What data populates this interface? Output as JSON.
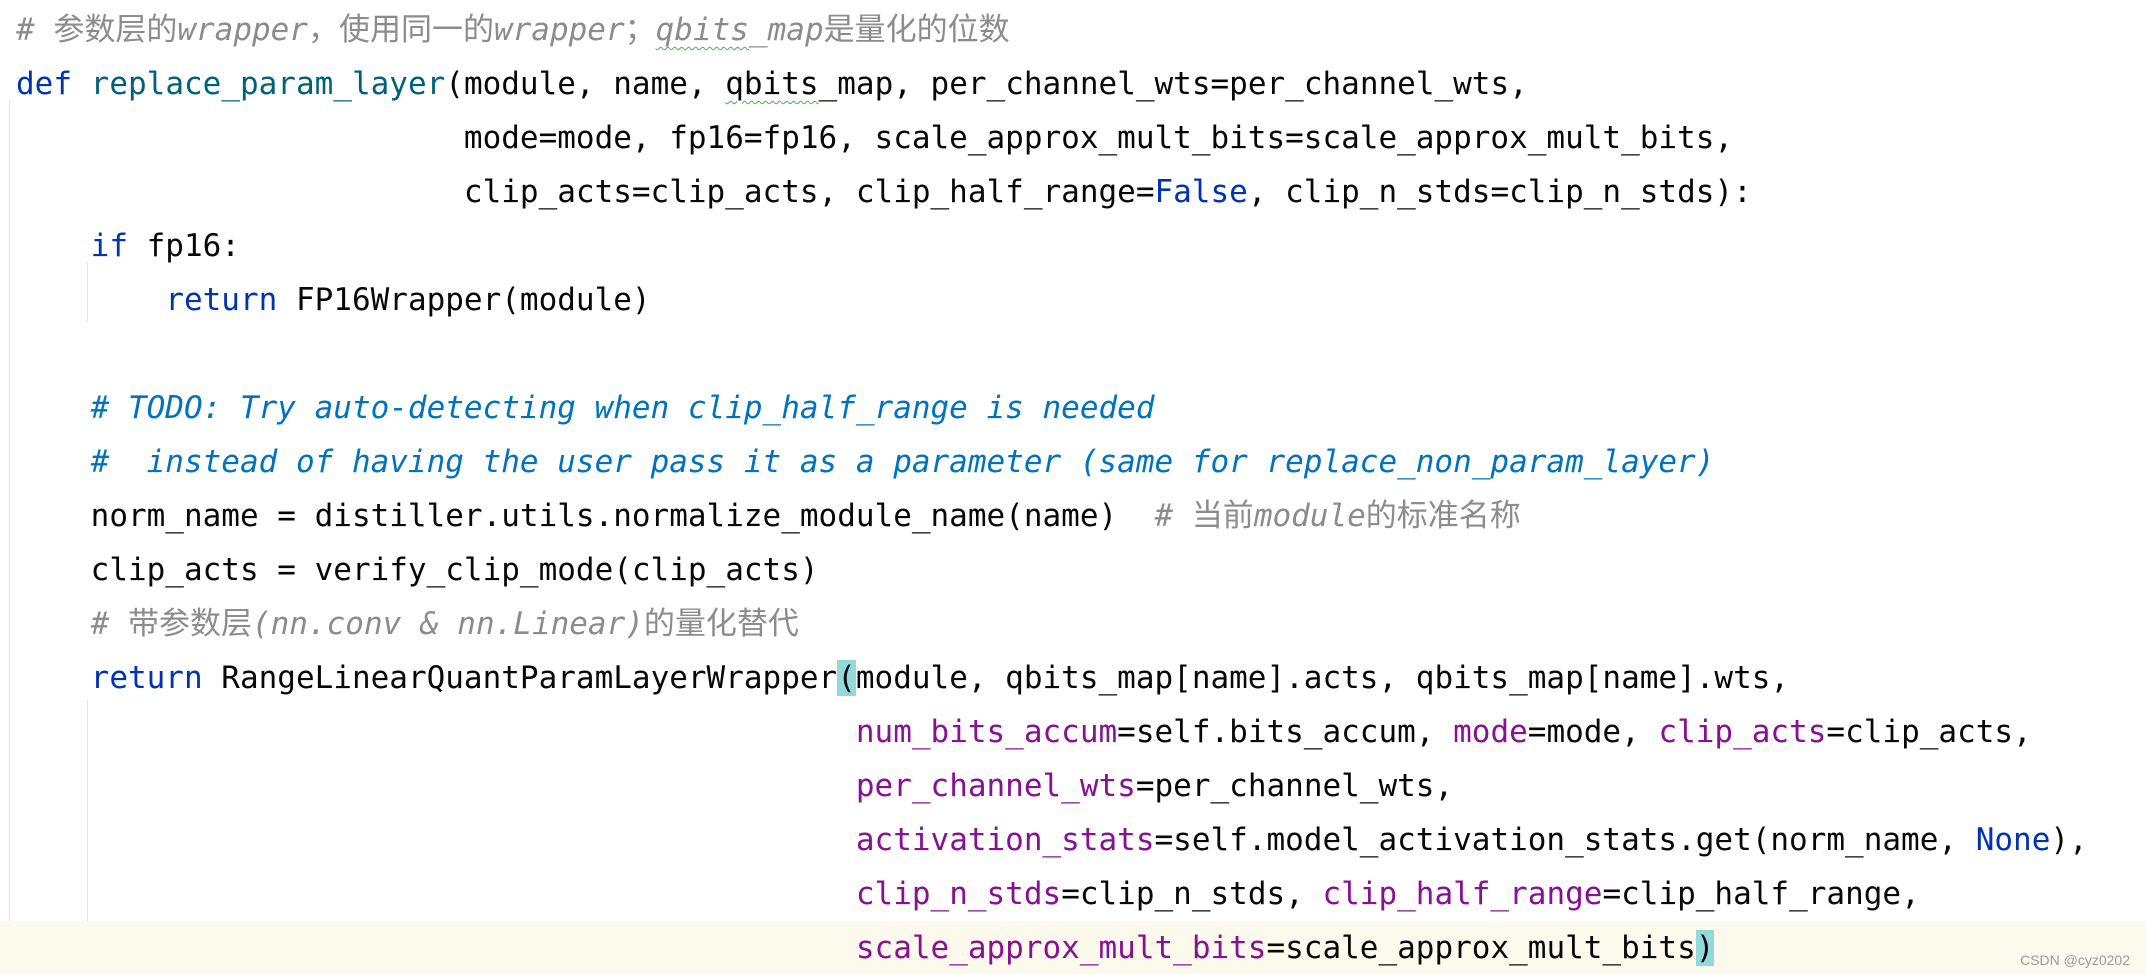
{
  "editor": {
    "lines": [
      [
        {
          "t": "# 参数层的wrapper，使用同一的wrapper；",
          "c": "cmt"
        },
        {
          "t": "qbits",
          "c": "cmt typo"
        },
        {
          "t": "_map是量化的位数",
          "c": "cmt"
        }
      ],
      [
        {
          "t": "def",
          "c": "kw"
        },
        {
          "t": " "
        },
        {
          "t": "replace_param_layer",
          "c": "fn"
        },
        {
          "t": "(module, name, "
        },
        {
          "t": "qbits",
          "c": "typo"
        },
        {
          "t": "_map, per_channel_wts=per_channel_wts,"
        }
      ],
      [
        {
          "t": "                        mode=mode, fp16=fp16, scale_approx_mult_bits=scale_approx_mult_bits,"
        }
      ],
      [
        {
          "t": "                        clip_acts=clip_acts, clip_half_range="
        },
        {
          "t": "False",
          "c": "kw"
        },
        {
          "t": ", clip_n_stds=clip_n_stds):"
        }
      ],
      [
        {
          "t": "    "
        },
        {
          "t": "if",
          "c": "kw"
        },
        {
          "t": " fp16:"
        }
      ],
      [
        {
          "t": "        "
        },
        {
          "t": "return",
          "c": "kw"
        },
        {
          "t": " FP16Wrapper(module)"
        }
      ],
      [],
      [
        {
          "t": "    "
        },
        {
          "t": "# TODO: Try auto-detecting when clip_half_range is needed",
          "c": "todo"
        }
      ],
      [
        {
          "t": "    "
        },
        {
          "t": "#  instead of having the user pass it as a parameter (same for replace_non_param_layer)",
          "c": "todo"
        }
      ],
      [
        {
          "t": "    norm_name = distiller.utils.normalize_module_name(name)  "
        },
        {
          "t": "# 当前module的标准名称",
          "c": "cmt"
        }
      ],
      [
        {
          "t": "    clip_acts = verify_clip_mode(clip_acts)"
        }
      ],
      [
        {
          "t": "    "
        },
        {
          "t": "# 带参数层(nn.conv & nn.Linear)的量化替代",
          "c": "cmt"
        }
      ],
      [
        {
          "t": "    "
        },
        {
          "t": "return",
          "c": "kw"
        },
        {
          "t": " RangeLinearQuantParamLayerWrapper"
        },
        {
          "t": "(",
          "c": "brace"
        },
        {
          "t": "module, qbits_map[name].acts, qbits_map[name].wts,"
        }
      ],
      [
        {
          "t": "                                             "
        },
        {
          "t": "num_bits_accum",
          "c": "param"
        },
        {
          "t": "=self.bits_accum, "
        },
        {
          "t": "mode",
          "c": "param"
        },
        {
          "t": "=mode, "
        },
        {
          "t": "clip_acts",
          "c": "param"
        },
        {
          "t": "=clip_acts,"
        }
      ],
      [
        {
          "t": "                                             "
        },
        {
          "t": "per_channel_wts",
          "c": "param"
        },
        {
          "t": "=per_channel_wts,"
        }
      ],
      [
        {
          "t": "                                             "
        },
        {
          "t": "activation_stats",
          "c": "param"
        },
        {
          "t": "=self.model_activation_stats.get(norm_name, "
        },
        {
          "t": "None",
          "c": "kw"
        },
        {
          "t": "),"
        }
      ],
      [
        {
          "t": "                                             "
        },
        {
          "t": "clip_n_stds",
          "c": "param"
        },
        {
          "t": "=clip_n_stds, "
        },
        {
          "t": "clip_half_range",
          "c": "param"
        },
        {
          "t": "=clip_half_range,"
        }
      ],
      [
        {
          "t": "                                             "
        },
        {
          "t": "scale_approx_mult_bits",
          "c": "param"
        },
        {
          "t": "=scale_approx_mult_bits"
        },
        {
          "t": ")",
          "c": "brace"
        }
      ]
    ],
    "current_line": 18
  },
  "watermark": "CSDN @cyz0202"
}
